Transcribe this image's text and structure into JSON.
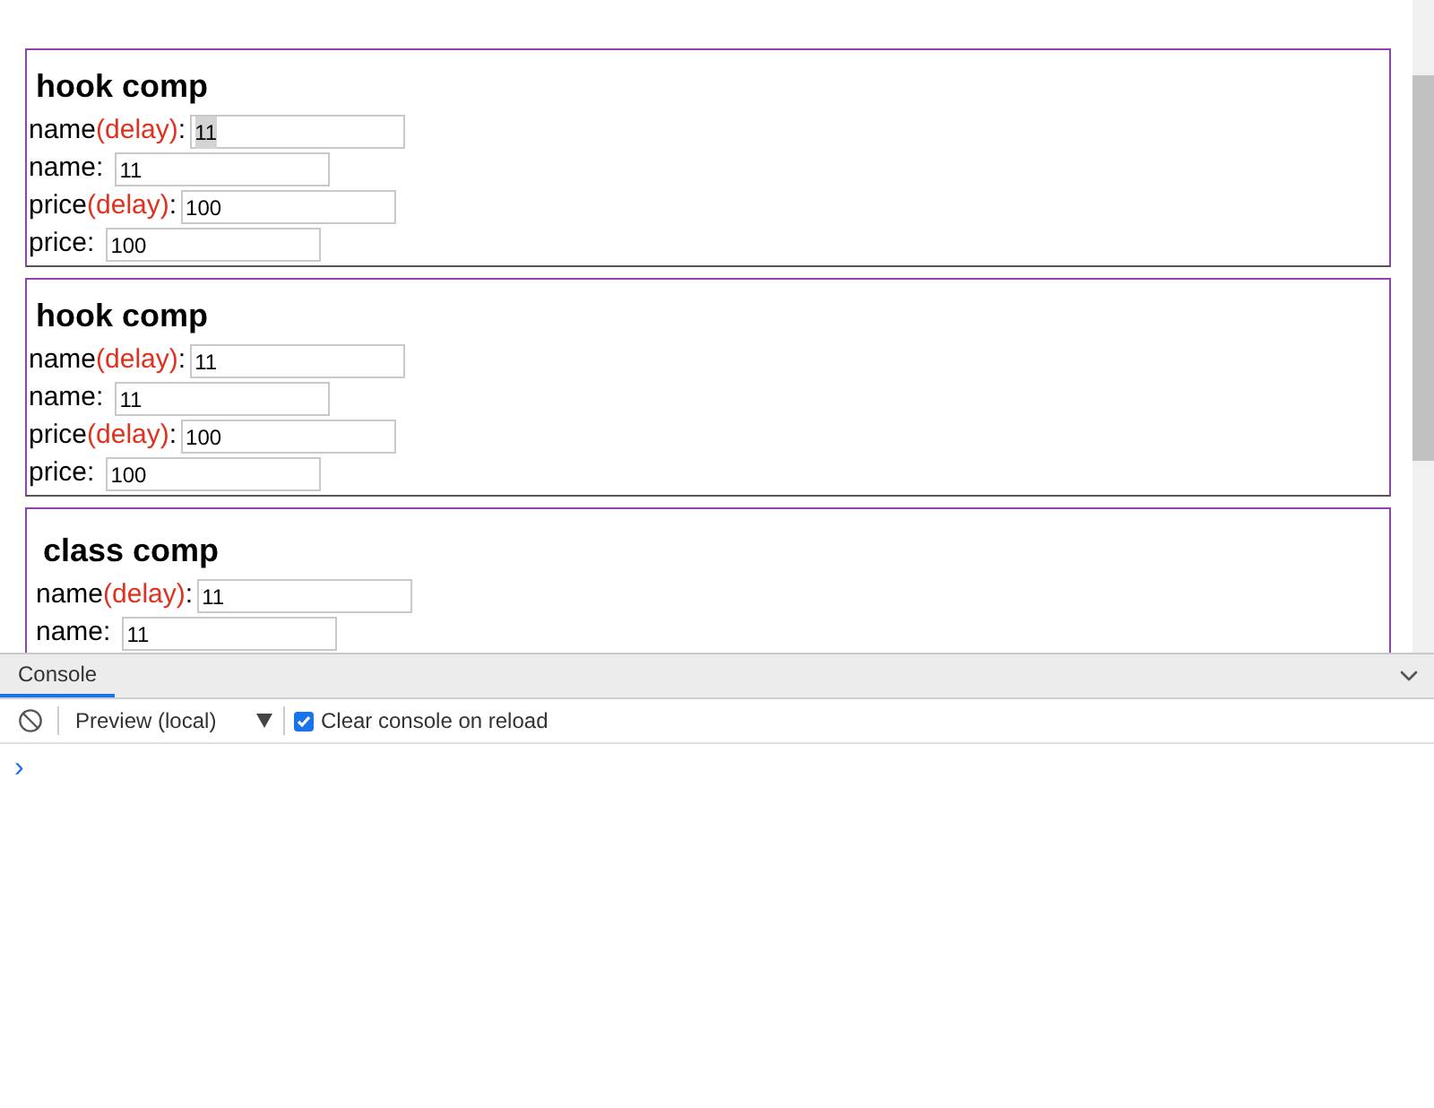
{
  "cards": [
    {
      "kind": "hook",
      "title": "hook comp",
      "rows": [
        {
          "label": "name",
          "note": "(delay)",
          "suffix": ":",
          "value": "11",
          "selected": true
        },
        {
          "label": "name:",
          "value": "11",
          "selected": false
        },
        {
          "label": "price",
          "note": "(delay)",
          "suffix": ":",
          "value": "100",
          "selected": false
        },
        {
          "label": "price:",
          "value": "100",
          "selected": false
        }
      ]
    },
    {
      "kind": "hook",
      "title": "hook comp",
      "rows": [
        {
          "label": "name",
          "note": "(delay)",
          "suffix": ":",
          "value": "11",
          "selected": false
        },
        {
          "label": "name:",
          "value": "11",
          "selected": false
        },
        {
          "label": "price",
          "note": "(delay)",
          "suffix": ":",
          "value": "100",
          "selected": false
        },
        {
          "label": "price:",
          "value": "100",
          "selected": false
        }
      ]
    },
    {
      "kind": "class",
      "title": "class comp",
      "rows": [
        {
          "label": "name",
          "note": "(delay)",
          "suffix": ":",
          "value": "11",
          "selected": false
        },
        {
          "label": "name:",
          "value": "11",
          "selected": false
        }
      ]
    }
  ],
  "console": {
    "tab": "Console",
    "context": "Preview (local)",
    "clear_on_reload": {
      "label": "Clear console on reload",
      "checked": true
    },
    "prompt": "›"
  }
}
